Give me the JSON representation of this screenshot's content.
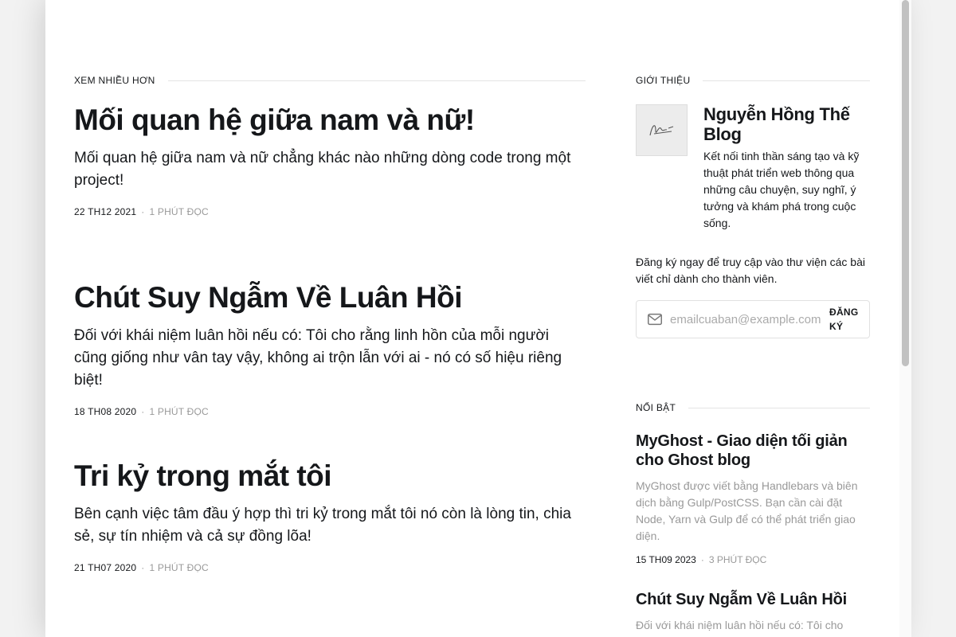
{
  "main": {
    "section_title": "XEM NHIỀU HƠN",
    "posts": [
      {
        "title": "Mối quan hệ giữa nam và nữ!",
        "excerpt": "Mối quan hệ giữa nam và nữ chẳng khác nào những dòng code trong một project!",
        "date": "22 TH12 2021",
        "read_time": "1 PHÚT ĐỌC"
      },
      {
        "title": "Chút Suy Ngẫm Về Luân Hồi",
        "excerpt": "Đối với khái niệm luân hồi nếu có: Tôi cho rằng linh hồn của mỗi người cũng giống như vân tay vậy, không ai trộn lẫn với ai - nó có số hiệu riêng biệt!",
        "date": "18 TH08 2020",
        "read_time": "1 PHÚT ĐỌC"
      },
      {
        "title": "Tri kỷ trong mắt tôi",
        "excerpt": "Bên cạnh việc tâm đầu ý hợp thì tri kỷ trong mắt tôi nó còn là lòng tin, chia sẻ, sự tín nhiệm và cả sự đồng lõa!",
        "date": "21 TH07 2020",
        "read_time": "1 PHÚT ĐỌC"
      }
    ],
    "meta_separator": "·"
  },
  "sidebar": {
    "about_title": "GIỚI THIỆU",
    "author_name": "Nguyễn Hồng Thế Blog",
    "author_desc": "Kết nối tinh thần sáng tạo và kỹ thuật phát triển web thông qua những câu chuyện, suy nghĩ, ý tưởng và khám phá trong cuộc sống.",
    "subscribe_text": "Đăng ký ngay để truy cập vào thư viện các bài viết chỉ dành cho thành viên.",
    "email_placeholder": "emailcuaban@example.com",
    "subscribe_button": "ĐĂNG KÝ",
    "featured_title": "NỔI BẬT",
    "featured": [
      {
        "title": "MyGhost - Giao diện tối giản cho Ghost blog",
        "excerpt": "MyGhost được viết bằng Handlebars và biên dịch bằng Gulp/PostCSS. Bạn cần cài đặt Node, Yarn và Gulp để có thể phát triển giao diện.",
        "date": "15 TH09 2023",
        "read_time": "3 PHÚT ĐỌC"
      },
      {
        "title": "Chút Suy Ngẫm Về Luân Hồi",
        "excerpt": "Đối với khái niệm luân hồi nếu có: Tôi cho"
      }
    ]
  },
  "icons": {
    "mail": "mail-icon",
    "avatar": "signature-avatar"
  }
}
